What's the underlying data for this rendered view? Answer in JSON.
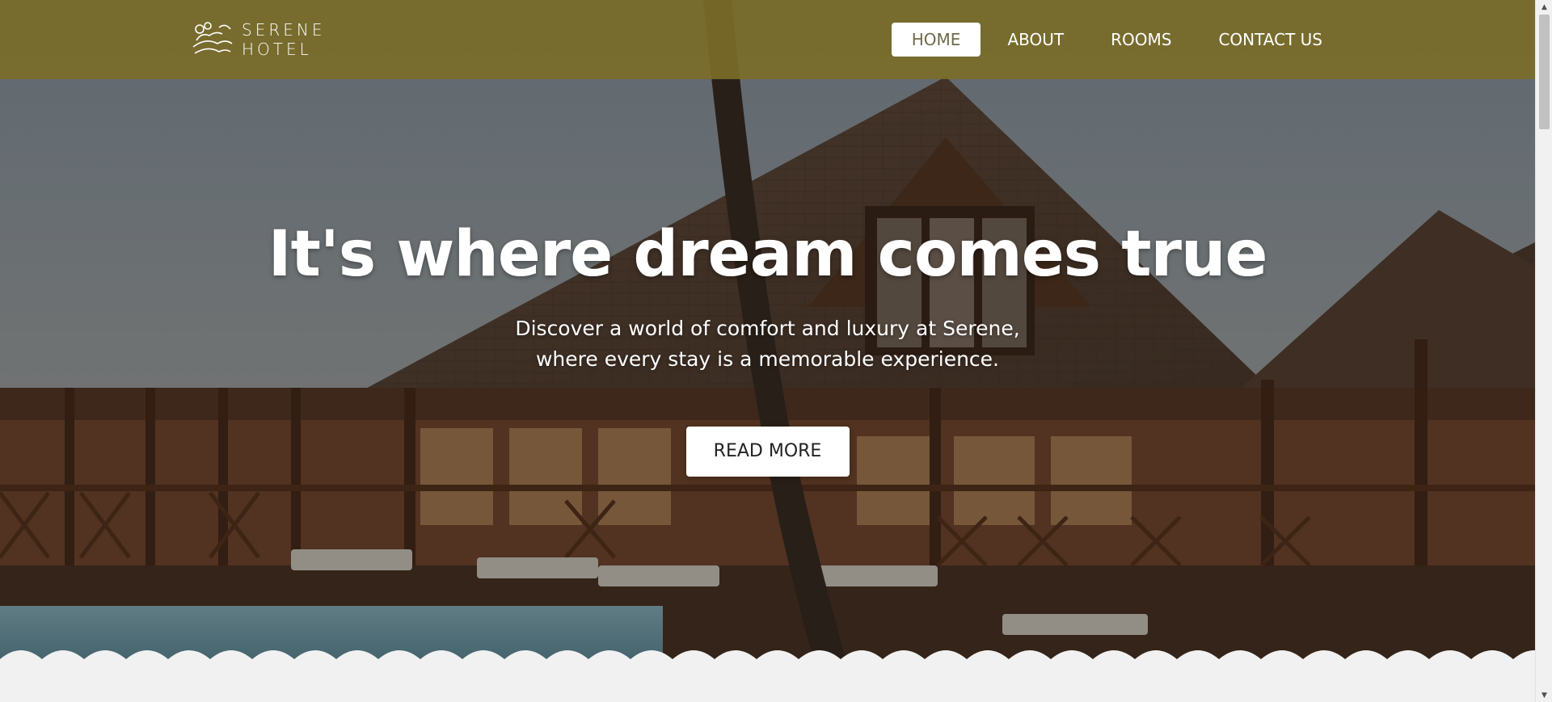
{
  "logo": {
    "line1": "SERENE",
    "line2": "HOTEL",
    "icon": "serene-lotus-wave-logo"
  },
  "nav": {
    "items": [
      {
        "label": "HOME",
        "active": true
      },
      {
        "label": "ABOUT",
        "active": false
      },
      {
        "label": "ROOMS",
        "active": false
      },
      {
        "label": "CONTACT US",
        "active": false
      }
    ]
  },
  "hero": {
    "title": "It's where dream comes true",
    "subtitle_line1": "Discover a world of comfort and luxury at Serene,",
    "subtitle_line2": "where every stay is a memorable experience.",
    "cta_label": "READ MORE"
  },
  "colors": {
    "navbar": "#7a6c28",
    "cta_background": "#ffffff",
    "page_background": "#f1f1f1"
  },
  "scrollbar": {
    "up_icon": "scroll-up-arrow-icon",
    "down_icon": "scroll-down-arrow-icon"
  }
}
